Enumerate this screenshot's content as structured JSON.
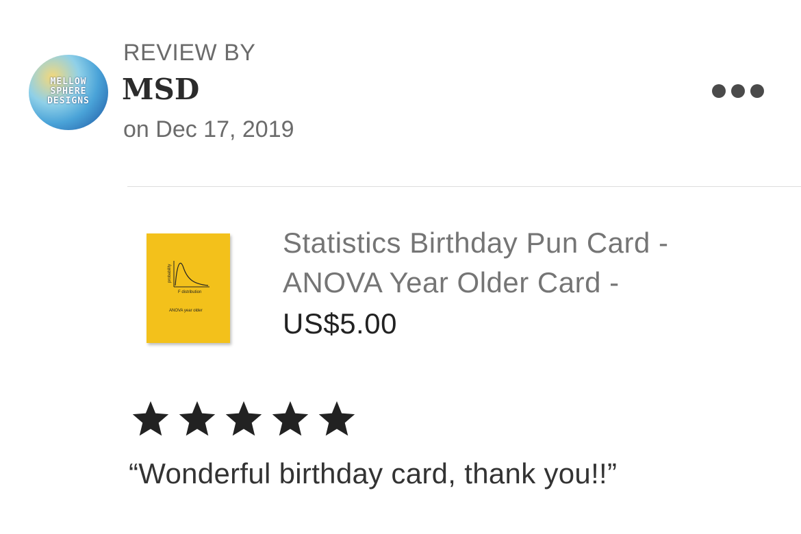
{
  "reviewer": {
    "avatar_logo_lines": [
      "MELLOW",
      "SPHERE",
      "DESIGNS"
    ],
    "label": "REVIEW BY",
    "name": "MSD",
    "date": "on Dec 17, 2019"
  },
  "menu": {
    "icon": "more-horizontal-icon"
  },
  "listing": {
    "thumbnail": {
      "ylabel": "probability",
      "xlabel": "F distribution",
      "caption": "ANOVA year older",
      "color": "#f3c11b"
    },
    "title_line1": "Statistics Birthday Pun Card -",
    "title_line2": "ANOVA Year Older Card -",
    "price": "US$5.00"
  },
  "rating": {
    "stars": 5,
    "max": 5,
    "icon": "star-icon"
  },
  "review_text": "“Wonderful birthday card, thank you!!”"
}
